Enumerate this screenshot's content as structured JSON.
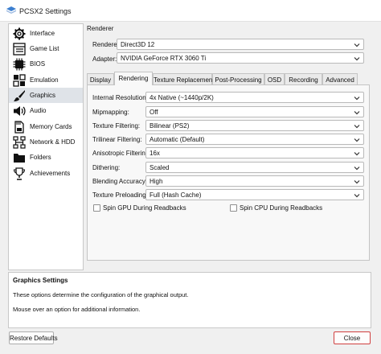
{
  "window": {
    "title": "PCSX2 Settings"
  },
  "sidebar": {
    "items": [
      {
        "label": "Interface",
        "icon": "gear-icon"
      },
      {
        "label": "Game List",
        "icon": "game-list-icon"
      },
      {
        "label": "BIOS",
        "icon": "bios-chip-icon"
      },
      {
        "label": "Emulation",
        "icon": "emulation-grid-icon"
      },
      {
        "label": "Graphics",
        "icon": "brush-icon",
        "selected": true
      },
      {
        "label": "Audio",
        "icon": "speaker-icon"
      },
      {
        "label": "Memory Cards",
        "icon": "memory-card-icon"
      },
      {
        "label": "Network & HDD",
        "icon": "network-icon"
      },
      {
        "label": "Folders",
        "icon": "folder-icon"
      },
      {
        "label": "Achievements",
        "icon": "trophy-icon"
      }
    ]
  },
  "renderer": {
    "header": "Renderer",
    "renderer_label": "Renderer:",
    "renderer_value": "Direct3D 12",
    "adapter_label": "Adapter:",
    "adapter_value": "NVIDIA GeForce RTX 3060 Ti"
  },
  "tabs": [
    {
      "label": "Display"
    },
    {
      "label": "Rendering",
      "selected": true
    },
    {
      "label": "Texture Replacement"
    },
    {
      "label": "Post-Processing"
    },
    {
      "label": "OSD"
    },
    {
      "label": "Recording"
    },
    {
      "label": "Advanced"
    }
  ],
  "rendering": {
    "settings": [
      {
        "label": "Internal Resolution:",
        "value": "4x Native (~1440p/2K)"
      },
      {
        "label": "Mipmapping:",
        "value": "Off"
      },
      {
        "label": "Texture Filtering:",
        "value": "Bilinear (PS2)"
      },
      {
        "label": "Trilinear Filtering:",
        "value": "Automatic (Default)"
      },
      {
        "label": "Anisotropic Filtering:",
        "value": "16x"
      },
      {
        "label": "Dithering:",
        "value": "Scaled"
      },
      {
        "label": "Blending Accuracy:",
        "value": "High"
      },
      {
        "label": "Texture Preloading:",
        "value": "Full (Hash Cache)"
      }
    ],
    "spin_gpu_label": "Spin GPU During Readbacks",
    "spin_gpu_checked": false,
    "spin_cpu_label": "Spin CPU During Readbacks",
    "spin_cpu_checked": false
  },
  "description": {
    "title": "Graphics Settings",
    "line1": "These options determine the configuration of the graphical output.",
    "line2": "Mouse over an option for additional information."
  },
  "buttons": {
    "restore_defaults": "Restore Defaults",
    "close": "Close"
  },
  "colors": {
    "selection": "#dfe3e8",
    "close_border": "#d04040"
  }
}
